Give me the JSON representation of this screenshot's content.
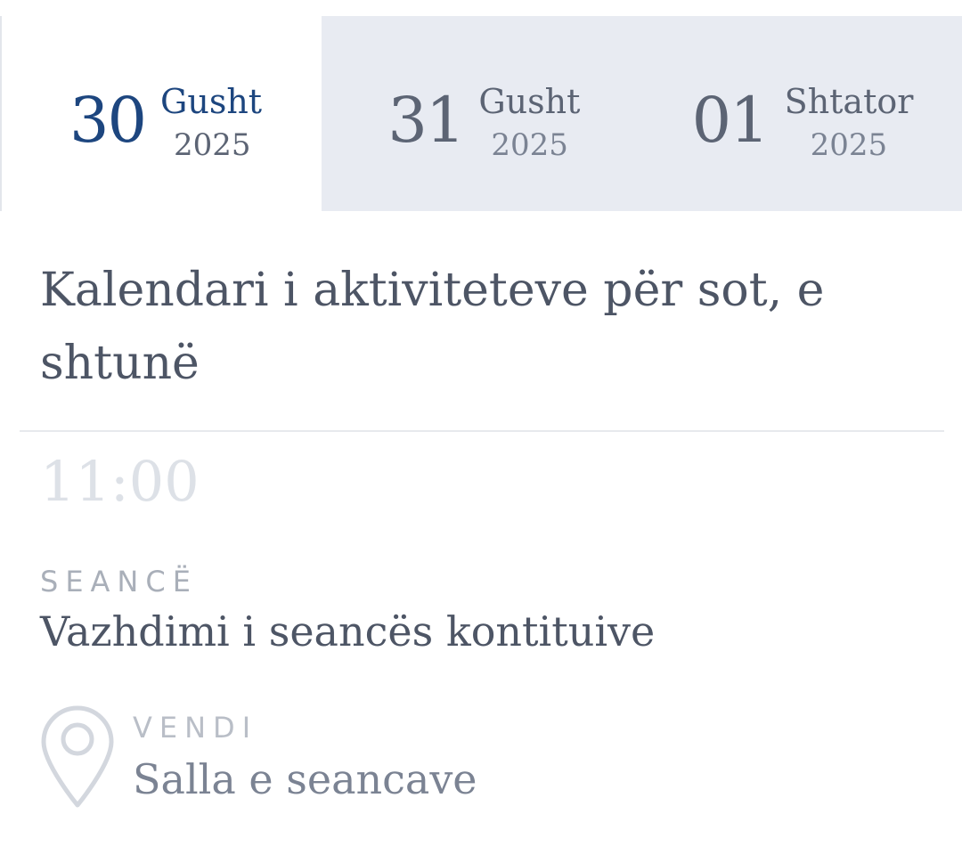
{
  "date_tabs": [
    {
      "day": "30",
      "month": "Gusht",
      "year": "2025",
      "active": true
    },
    {
      "day": "31",
      "month": "Gusht",
      "year": "2025",
      "active": false
    },
    {
      "day": "01",
      "month": "Shtator",
      "year": "2025",
      "active": false
    }
  ],
  "heading": "Kalendari i aktiviteteve për sot, e shtunë",
  "events": [
    {
      "time": "11:00",
      "type_label": "SEANCË",
      "type_value": "Vazhdimi i seancës kontituive",
      "place_label": "VENDI",
      "place_value": "Salla e seancave",
      "place_icon": "location-pin-icon"
    }
  ],
  "colors": {
    "accent": "#1d467f",
    "tab_inactive_bg": "#e8ebf2",
    "text_primary": "#4d5565",
    "text_muted": "#a9afb9",
    "time_faded": "#dde1e7"
  }
}
